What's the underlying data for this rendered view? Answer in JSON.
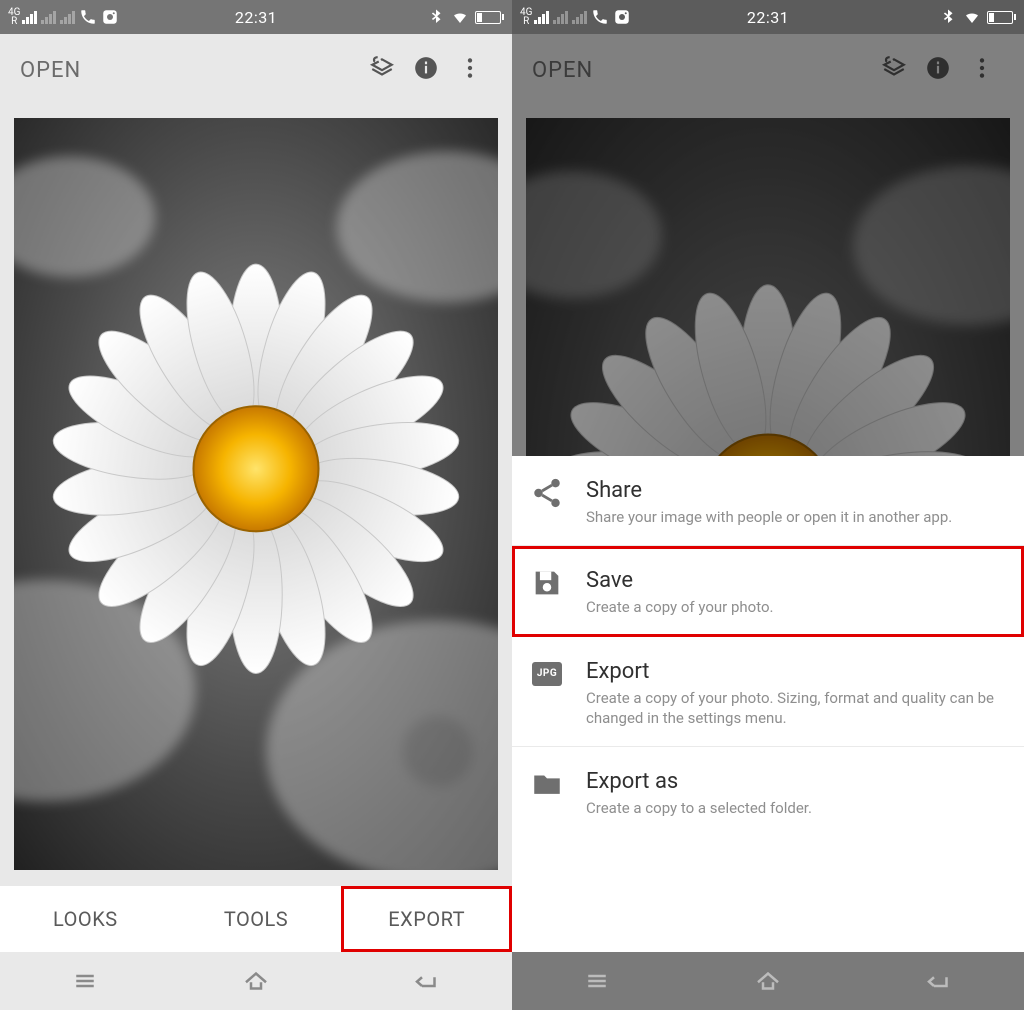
{
  "status": {
    "network": "4G",
    "roaming": "R",
    "time": "22:31"
  },
  "app": {
    "title": "OPEN"
  },
  "tabs": {
    "looks": "LOOKS",
    "tools": "TOOLS",
    "export": "EXPORT"
  },
  "sheet": {
    "share": {
      "title": "Share",
      "desc": "Share your image with people or open it in another app."
    },
    "save": {
      "title": "Save",
      "desc": "Create a copy of your photo."
    },
    "export": {
      "title": "Export",
      "desc": "Create a copy of your photo. Sizing, format and quality can be changed in the settings menu.",
      "badge": "JPG"
    },
    "exportas": {
      "title": "Export as",
      "desc": "Create a copy to a selected folder."
    }
  }
}
